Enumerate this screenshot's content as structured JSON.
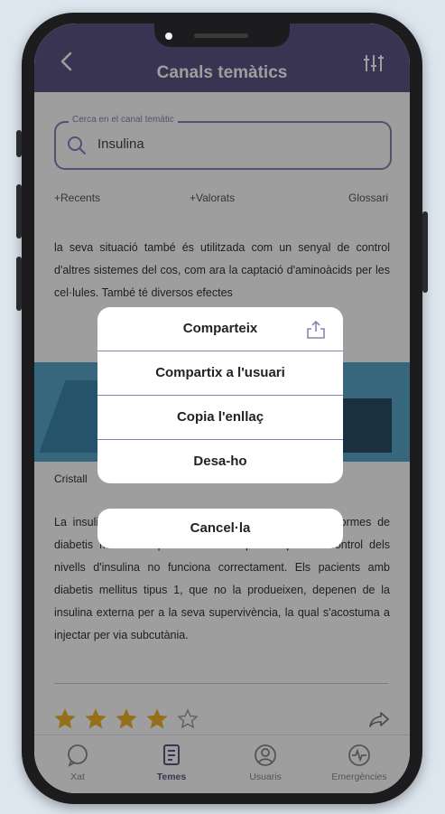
{
  "header": {
    "title": "Canals temàtics"
  },
  "search": {
    "legend": "Cerca en el canal temàtic",
    "value": "Insulina"
  },
  "tabs": [
    "+Recents",
    "+Valorats",
    "Glossari"
  ],
  "article": {
    "paragraph1": "la seva situació també és utilitzada com un senyal de control d'altres sistemes del cos, com ara la captació d'aminoàcids per les cel·lules. També té diversos efectes",
    "image_caption": "Cristall",
    "paragraph2": "La insulina s'utilitza mèdicament per tractar algunes formes de diabetis mellitus. Aquesta malaltia apareix quan el control dels nivells d'insulina no funciona correctament. Els pacients amb diabetis mellitus tipus 1, que no la produeixen, depenen de la insulina externa per a la seva supervivència, la qual s'acostuma a injectar per via subcutània."
  },
  "rating": {
    "value": 4,
    "max": 5
  },
  "bottom_nav": [
    {
      "label": "Xat",
      "icon": "chat-icon"
    },
    {
      "label": "Temes",
      "icon": "document-icon"
    },
    {
      "label": "Usuaris",
      "icon": "user-icon"
    },
    {
      "label": "Emergències",
      "icon": "emergency-icon"
    }
  ],
  "action_sheet": {
    "items": [
      "Comparteix",
      "Compartix a l'usuari",
      "Copia l'enllaç",
      "Desa-ho"
    ],
    "cancel": "Cancel·la"
  },
  "colors": {
    "header": "#5d5485",
    "accent": "#8a82b6",
    "star": "#f0b429"
  }
}
